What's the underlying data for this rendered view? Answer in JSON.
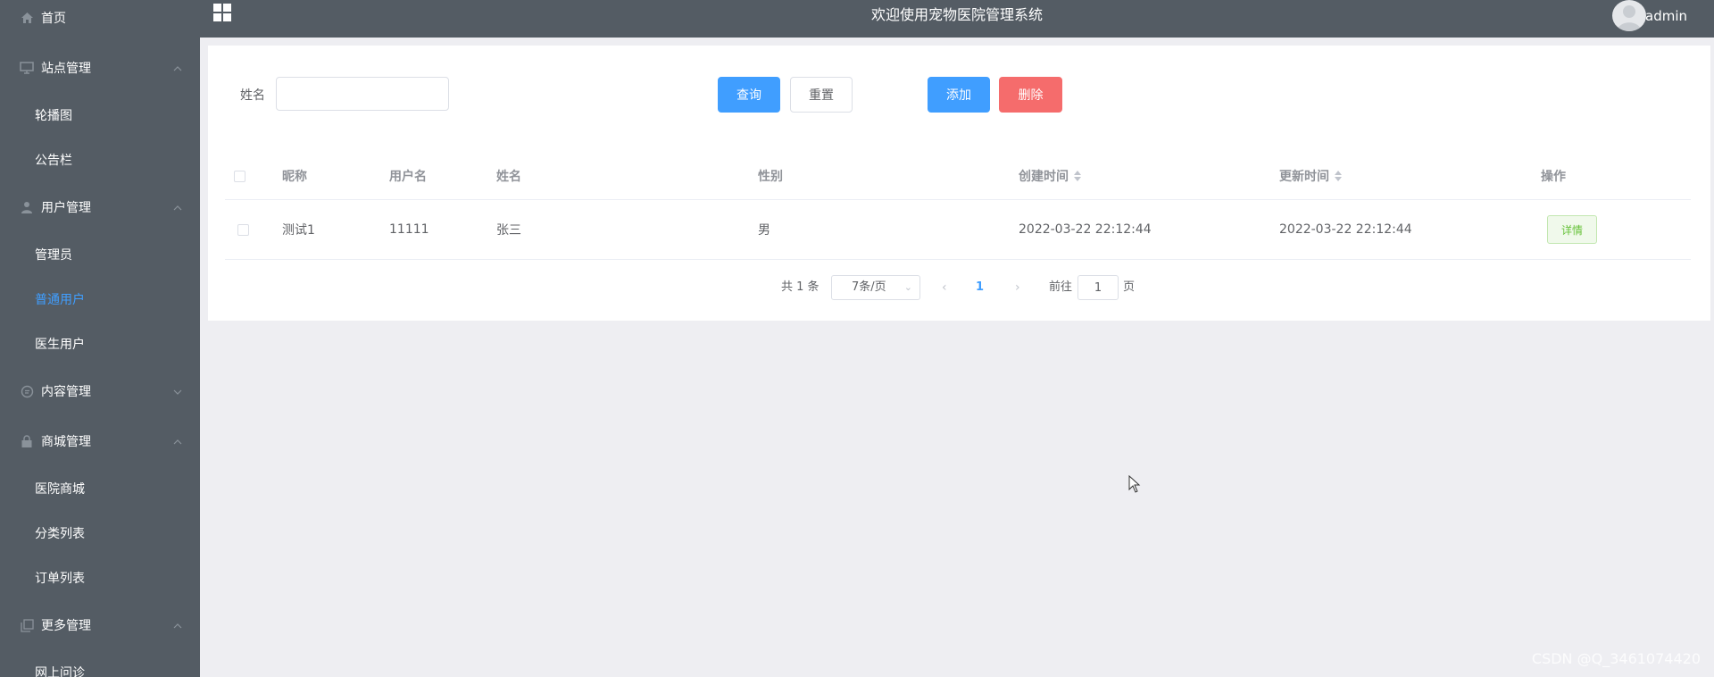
{
  "header": {
    "title": "欢迎使用宠物医院管理系统",
    "user": "admin"
  },
  "sidebar": {
    "items": [
      {
        "label": "首页",
        "icon": "home-icon"
      },
      {
        "label": "站点管理",
        "icon": "monitor-icon"
      },
      {
        "label": "轮播图"
      },
      {
        "label": "公告栏"
      },
      {
        "label": "用户管理",
        "icon": "user-icon"
      },
      {
        "label": "管理员"
      },
      {
        "label": "普通用户"
      },
      {
        "label": "医生用户"
      },
      {
        "label": "内容管理",
        "icon": "chat-icon"
      },
      {
        "label": "商城管理",
        "icon": "lock-icon"
      },
      {
        "label": "医院商城"
      },
      {
        "label": "分类列表"
      },
      {
        "label": "订单列表"
      },
      {
        "label": "更多管理",
        "icon": "copy-icon"
      },
      {
        "label": "网上问诊"
      }
    ]
  },
  "search": {
    "label": "姓名",
    "value": "",
    "placeholder": ""
  },
  "buttons": {
    "query": "查询",
    "reset": "重置",
    "add": "添加",
    "delete": "删除"
  },
  "table": {
    "columns": [
      "昵称",
      "用户名",
      "姓名",
      "性别",
      "创建时间",
      "更新时间",
      "操作"
    ],
    "rows": [
      {
        "nickname": "测试1",
        "username": "11111",
        "name": "张三",
        "gender": "男",
        "created": "2022-03-22 22:12:44",
        "updated": "2022-03-22 22:12:44",
        "action": "详情"
      }
    ]
  },
  "pagination": {
    "total_text": "共 1 条",
    "page_size": "7条/页",
    "current_page": "1",
    "goto_label": "前往",
    "goto_value": "1",
    "goto_suffix": "页"
  },
  "watermark": "CSDN @Q_3461074420",
  "colors": {
    "sidebar_bg": "#545c64",
    "primary": "#409eff",
    "danger": "#f56c6c",
    "success": "#67c23a"
  }
}
